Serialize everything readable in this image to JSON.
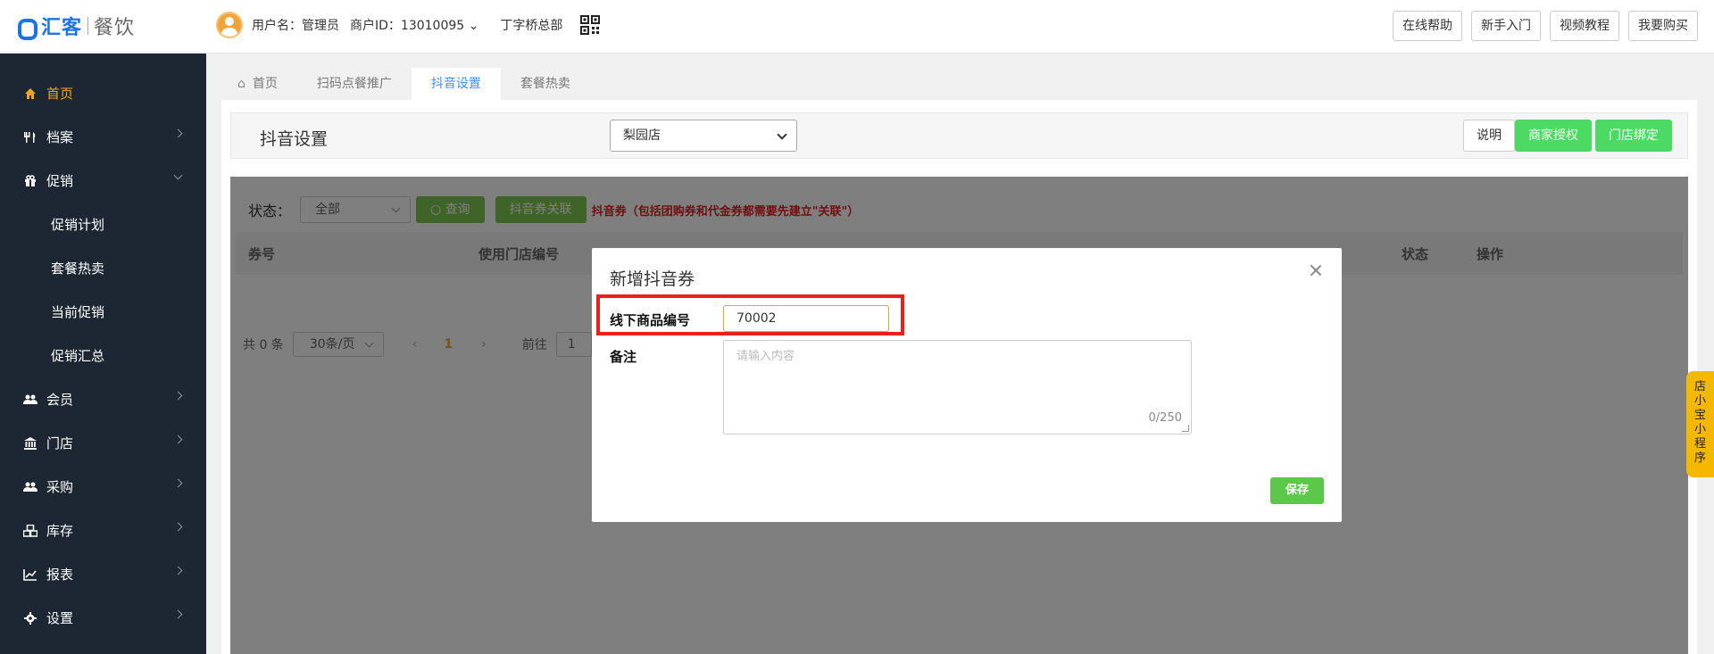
{
  "header": {
    "brand": "汇客",
    "brand_sub": "餐饮",
    "username": "用户名：管理员",
    "merchant_id": "商户ID：13010095",
    "store": "丁字桥总部",
    "buttons": [
      "在线帮助",
      "新手入门",
      "视频教程",
      "我要购买"
    ]
  },
  "sidebar": {
    "items": [
      {
        "label": "首页",
        "icon": "home-icon",
        "active": true
      },
      {
        "label": "档案",
        "icon": "utensils-icon"
      },
      {
        "label": "促销",
        "icon": "gift-icon",
        "expanded": true
      },
      {
        "label": "会员",
        "icon": "users-icon"
      },
      {
        "label": "门店",
        "icon": "bank-icon"
      },
      {
        "label": "采购",
        "icon": "users-icon"
      },
      {
        "label": "库存",
        "icon": "cubes-icon"
      },
      {
        "label": "报表",
        "icon": "line-chart-icon"
      },
      {
        "label": "设置",
        "icon": "gear-icon"
      }
    ],
    "sub_items": [
      "促销计划",
      "套餐热卖",
      "当前促销",
      "促销汇总"
    ]
  },
  "tabs": [
    "首页",
    "扫码点餐推广",
    "抖音设置",
    "套餐热卖"
  ],
  "active_tab": "抖音设置",
  "title_bar": {
    "title": "抖音设置",
    "store_select": "梨园店",
    "btn_help": "说明",
    "btn_auth": "商家授权",
    "btn_bind": "门店绑定"
  },
  "filter": {
    "status_label": "状态：",
    "status_value": "全部",
    "query_label": "查询",
    "link_label": "抖音券关联",
    "warning": "抖音券（包括团购券和代金券都需要先建立\"关联\"）"
  },
  "table": {
    "headers": [
      "券号",
      "使用门店编号",
      "状态",
      "操作"
    ]
  },
  "pager": {
    "total": "共 0 条",
    "page_size": "30条/页",
    "current": "1",
    "goto_label": "前往",
    "goto_value": "1"
  },
  "modal": {
    "title": "新增抖音券",
    "field1_label": "线下商品编号",
    "field1_value": "70002",
    "field2_label": "备注",
    "field2_placeholder": "请输入内容",
    "char_count": "0/250",
    "save_label": "保存"
  },
  "float_tab": [
    "店",
    "小",
    "宝",
    "小",
    "程",
    "序"
  ],
  "colors": {
    "sidebar_bg": "#1c2733",
    "active_orange": "#f5a623",
    "brand_blue": "#1a73e8",
    "green": "#4cd964",
    "highlight_red": "#e8211c"
  }
}
